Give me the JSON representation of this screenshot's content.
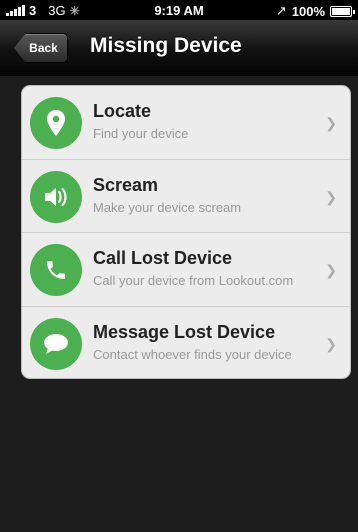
{
  "status_bar": {
    "carrier": "3",
    "network": "3G",
    "time": "9:19 AM",
    "location_arrow": "↗",
    "battery": "100%"
  },
  "nav": {
    "back_label": "Back",
    "title": "Missing Device"
  },
  "accent_color": "#4caf50",
  "items": [
    {
      "title": "Locate",
      "subtitle": "Find your device",
      "icon": "location-pin-icon"
    },
    {
      "title": "Scream",
      "subtitle": "Make your device scream",
      "icon": "speaker-icon"
    },
    {
      "title": "Call Lost Device",
      "subtitle": "Call your device from Lookout.com",
      "icon": "phone-icon"
    },
    {
      "title": "Message Lost Device",
      "subtitle": "Contact whoever finds your device",
      "icon": "chat-bubble-icon"
    }
  ]
}
